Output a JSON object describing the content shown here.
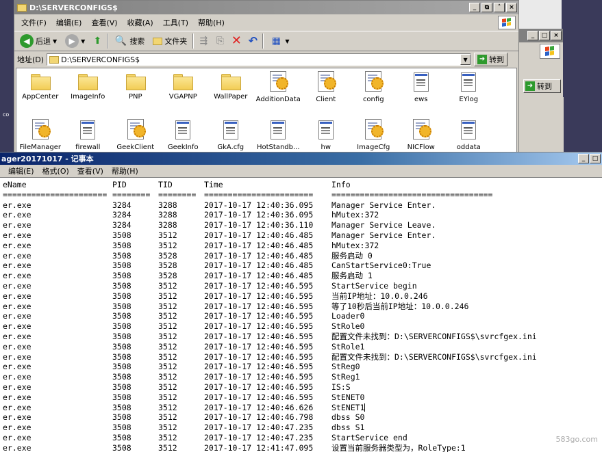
{
  "explorer": {
    "title": "D:\\SERVERCONFIGS$",
    "menu": [
      "文件(F)",
      "编辑(E)",
      "查看(V)",
      "收藏(A)",
      "工具(T)",
      "帮助(H)"
    ],
    "toolbar": {
      "back": "后退",
      "search": "搜索",
      "folders": "文件夹"
    },
    "address": {
      "label": "地址(D)",
      "value": "D:\\SERVERCONFIGS$",
      "go": "转到"
    },
    "files": [
      {
        "name": "AppCenter",
        "kind": "folder"
      },
      {
        "name": "ImageInfo",
        "kind": "folder"
      },
      {
        "name": "PNP",
        "kind": "folder"
      },
      {
        "name": "VGAPNP",
        "kind": "folder"
      },
      {
        "name": "WallPaper",
        "kind": "folder"
      },
      {
        "name": "AdditionData",
        "kind": "cfg"
      },
      {
        "name": "Client",
        "kind": "cfg"
      },
      {
        "name": "config",
        "kind": "cfg"
      },
      {
        "name": "ews",
        "kind": "ini"
      },
      {
        "name": "EYlog",
        "kind": "ini"
      },
      {
        "name": "FileManager",
        "kind": "cfg"
      },
      {
        "name": "firewall",
        "kind": "ini"
      },
      {
        "name": "GeekClient",
        "kind": "cfg"
      },
      {
        "name": "GeekInfo",
        "kind": "ini"
      },
      {
        "name": "GkA.cfg",
        "kind": "ini"
      },
      {
        "name": "HotStandb...",
        "kind": "ini"
      },
      {
        "name": "hw",
        "kind": "ini"
      },
      {
        "name": "ImageCfg",
        "kind": "cfg"
      },
      {
        "name": "NICFlow",
        "kind": "cfg"
      },
      {
        "name": "oddata",
        "kind": "ini"
      }
    ]
  },
  "background_window": {
    "go": "转到"
  },
  "desktop": {
    "label": "co"
  },
  "notepad": {
    "title": "ager20171017 - 记事本",
    "menu": [
      "编辑(E)",
      "格式(O)",
      "查看(V)",
      "帮助(H)"
    ],
    "headers": [
      "eName",
      "PID",
      "TID",
      "Time",
      "Info"
    ],
    "separators": [
      "======================",
      "========",
      "========",
      "=======================",
      "=================================="
    ],
    "rows": [
      [
        "er.exe",
        "3284",
        "3288",
        "2017-10-17 12:40:36.095",
        "Manager Service Enter."
      ],
      [
        "er.exe",
        "3284",
        "3288",
        "2017-10-17 12:40:36.095",
        "hMutex:372"
      ],
      [
        "er.exe",
        "3284",
        "3288",
        "2017-10-17 12:40:36.110",
        "Manager Service Leave."
      ],
      [
        "er.exe",
        "3508",
        "3512",
        "2017-10-17 12:40:46.485",
        "Manager Service Enter."
      ],
      [
        "er.exe",
        "3508",
        "3512",
        "2017-10-17 12:40:46.485",
        "hMutex:372"
      ],
      [
        "er.exe",
        "3508",
        "3528",
        "2017-10-17 12:40:46.485",
        "服务启动 0"
      ],
      [
        "er.exe",
        "3508",
        "3528",
        "2017-10-17 12:40:46.485",
        "CanStartService0:True"
      ],
      [
        "er.exe",
        "3508",
        "3528",
        "2017-10-17 12:40:46.485",
        "服务启动 1"
      ],
      [
        "er.exe",
        "3508",
        "3512",
        "2017-10-17 12:40:46.595",
        "StartService begin"
      ],
      [
        "er.exe",
        "3508",
        "3512",
        "2017-10-17 12:40:46.595",
        "当前IP地址：10.0.0.246"
      ],
      [
        "er.exe",
        "3508",
        "3512",
        "2017-10-17 12:40:46.595",
        "等了10秒后当前IP地址：10.0.0.246"
      ],
      [
        "er.exe",
        "3508",
        "3512",
        "2017-10-17 12:40:46.595",
        "Loader0"
      ],
      [
        "er.exe",
        "3508",
        "3512",
        "2017-10-17 12:40:46.595",
        "StRole0"
      ],
      [
        "er.exe",
        "3508",
        "3512",
        "2017-10-17 12:40:46.595",
        "配置文件未找到：D:\\SERVERCONFIGS$\\svrcfgex.ini"
      ],
      [
        "er.exe",
        "3508",
        "3512",
        "2017-10-17 12:40:46.595",
        "StRole1"
      ],
      [
        "er.exe",
        "3508",
        "3512",
        "2017-10-17 12:40:46.595",
        "配置文件未找到：D:\\SERVERCONFIGS$\\svrcfgex.ini"
      ],
      [
        "er.exe",
        "3508",
        "3512",
        "2017-10-17 12:40:46.595",
        "StReg0"
      ],
      [
        "er.exe",
        "3508",
        "3512",
        "2017-10-17 12:40:46.595",
        "StReg1"
      ],
      [
        "er.exe",
        "3508",
        "3512",
        "2017-10-17 12:40:46.595",
        "IS:S"
      ],
      [
        "er.exe",
        "3508",
        "3512",
        "2017-10-17 12:40:46.595",
        "StENET0"
      ],
      [
        "er.exe",
        "3508",
        "3512",
        "2017-10-17 12:40:46.626",
        "StENET1"
      ],
      [
        "er.exe",
        "3508",
        "3512",
        "2017-10-17 12:40:46.798",
        "dbss S0"
      ],
      [
        "er.exe",
        "3508",
        "3512",
        "2017-10-17 12:40:47.235",
        "dbss S1"
      ],
      [
        "er.exe",
        "3508",
        "3512",
        "2017-10-17 12:40:47.235",
        "StartService end"
      ],
      [
        "er.exe",
        "3508",
        "3512",
        "2017-10-17 12:41:47.095",
        "设置当前服务器类型为，RoleType:1"
      ]
    ]
  },
  "watermark": "583go.com",
  "colors": {
    "notepad_title": "#0a246a",
    "explorer_title_inactive": "#808080",
    "go_green": "#2e9a2e"
  }
}
